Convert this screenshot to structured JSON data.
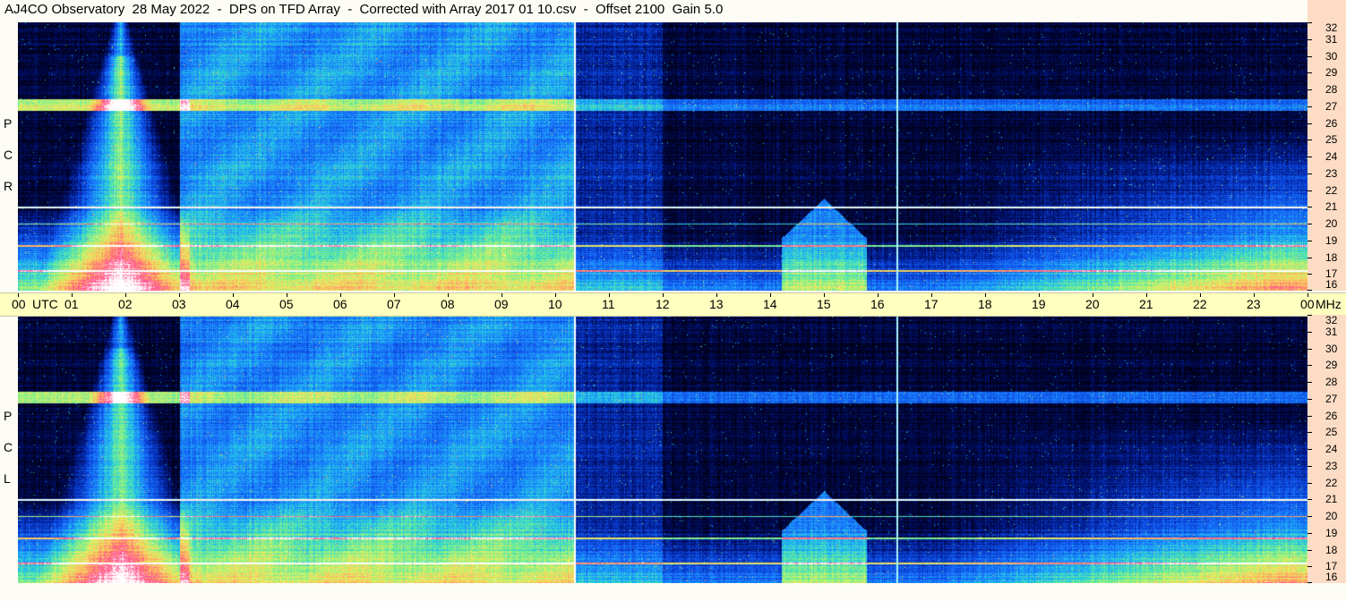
{
  "title": "AJ4CO Observatory  28 May 2022  -  DPS on TFD Array  -  Corrected with Array 2017 01 10.csv  -  Offset 2100  Gain 5.0",
  "panels": [
    {
      "label_letters": [
        "R",
        "C",
        "P"
      ]
    },
    {
      "label_letters": [
        "L",
        "C",
        "P"
      ]
    }
  ],
  "time_axis": {
    "labels": [
      "00",
      "01",
      "02",
      "03",
      "04",
      "05",
      "06",
      "07",
      "08",
      "09",
      "10",
      "11",
      "12",
      "13",
      "14",
      "15",
      "16",
      "17",
      "18",
      "19",
      "20",
      "21",
      "22",
      "23",
      "00"
    ],
    "unit": "UTC",
    "freq_unit": "MHz"
  },
  "chart_data": {
    "type": "heatmap",
    "x": {
      "label": "UTC",
      "range": [
        0,
        24
      ],
      "unit": "hours",
      "ticks": [
        "00",
        "01",
        "02",
        "03",
        "04",
        "05",
        "06",
        "07",
        "08",
        "09",
        "10",
        "11",
        "12",
        "13",
        "14",
        "15",
        "16",
        "17",
        "18",
        "19",
        "20",
        "21",
        "22",
        "23",
        "00"
      ]
    },
    "y": {
      "label": "MHz",
      "range": [
        16,
        32
      ],
      "ticks": [
        16,
        17,
        18,
        19,
        20,
        21,
        22,
        23,
        24,
        25,
        26,
        27,
        28,
        29,
        30,
        31,
        32
      ]
    },
    "series": [
      {
        "name": "RCP"
      },
      {
        "name": "LCP"
      }
    ],
    "features": {
      "vertical_lines_utc": [
        10.35,
        16.35
      ],
      "strong_band_mhz": 27.1,
      "horizontal_lines_mhz": [
        21.0,
        20.0,
        17.2,
        18.7
      ],
      "solar_burst_peak_utc": 1.9
    },
    "colormap": [
      "#000016",
      "#001070",
      "#0a40d8",
      "#1a78ff",
      "#22c8e8",
      "#70f090",
      "#e8f060",
      "#ffb060",
      "#ff4a8c",
      "#ffffff"
    ]
  }
}
